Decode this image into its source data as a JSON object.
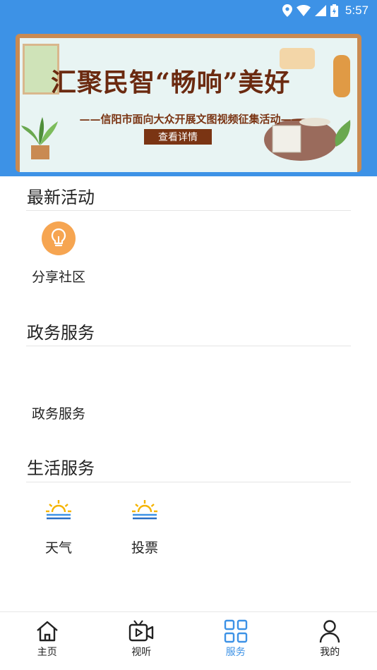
{
  "status_bar": {
    "time": "5:57"
  },
  "banner": {
    "title": "汇聚民智“畅响”美好",
    "subtitle": "——信阳市面向大众开展文图视频征集活动——",
    "button_label": "查看详情"
  },
  "sections": {
    "latest": {
      "title": "最新活动",
      "items": [
        {
          "label": "分享社区",
          "icon": "lightbulb-icon"
        }
      ]
    },
    "government": {
      "title": "政务服务",
      "items": [
        {
          "label": "政务服务"
        }
      ]
    },
    "life": {
      "title": "生活服务",
      "items": [
        {
          "label": "天气",
          "icon": "sunrise-icon"
        },
        {
          "label": "投票",
          "icon": "sunrise-icon"
        }
      ]
    }
  },
  "nav": {
    "items": [
      {
        "label": "主页",
        "icon": "home-icon"
      },
      {
        "label": "视听",
        "icon": "video-icon"
      },
      {
        "label": "服务",
        "icon": "grid-icon",
        "active": true
      },
      {
        "label": "我的",
        "icon": "person-icon"
      }
    ]
  },
  "colors": {
    "primary": "#3d92e6",
    "accent_orange": "#f6a551",
    "banner_text": "#6b2a10"
  }
}
